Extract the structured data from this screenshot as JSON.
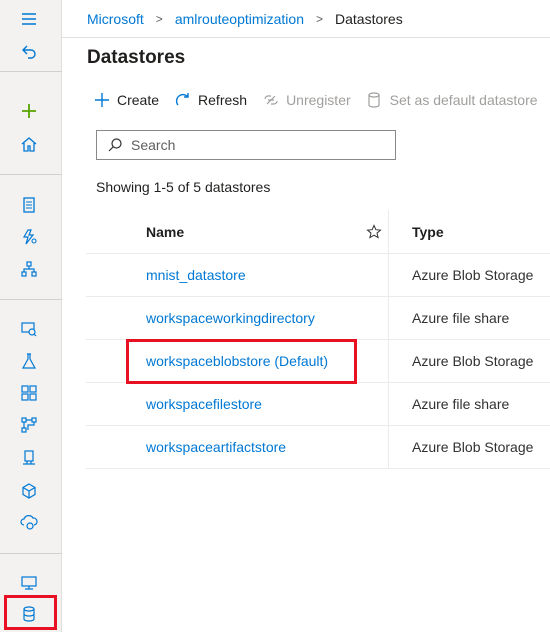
{
  "breadcrumb": {
    "items": [
      "Microsoft",
      "amlrouteoptimization"
    ],
    "current": "Datastores"
  },
  "page": {
    "title": "Datastores"
  },
  "toolbar": {
    "create_label": "Create",
    "refresh_label": "Refresh",
    "unregister_label": "Unregister",
    "set_default_label": "Set as default datastore"
  },
  "search": {
    "placeholder": "Search",
    "value": ""
  },
  "summary": {
    "showing_text": "Showing 1-5 of 5 datastores"
  },
  "table": {
    "columns": {
      "name": "Name",
      "type": "Type"
    },
    "rows": [
      {
        "name": "mnist_datastore",
        "type": "Azure Blob Storage"
      },
      {
        "name": "workspaceworkingdirectory",
        "type": "Azure file share"
      },
      {
        "name": "workspaceblobstore (Default)",
        "type": "Azure Blob Storage"
      },
      {
        "name": "workspacefilestore",
        "type": "Azure file share"
      },
      {
        "name": "workspaceartifactstore",
        "type": "Azure Blob Storage"
      }
    ]
  },
  "sidebar": {
    "icons": [
      "hamburger-icon",
      "back-icon",
      "plus-icon",
      "home-icon",
      "notebook-icon",
      "automl-icon",
      "designer-icon",
      "datasets-icon",
      "experiments-icon",
      "pipelines-icon",
      "models-icon",
      "endpoints-icon",
      "compute-icon",
      "environments-icon",
      "compute-target-icon",
      "datastores-icon"
    ]
  },
  "colors": {
    "accent": "#0078d4",
    "highlight": "#e81123",
    "green_plus": "#57a300"
  }
}
